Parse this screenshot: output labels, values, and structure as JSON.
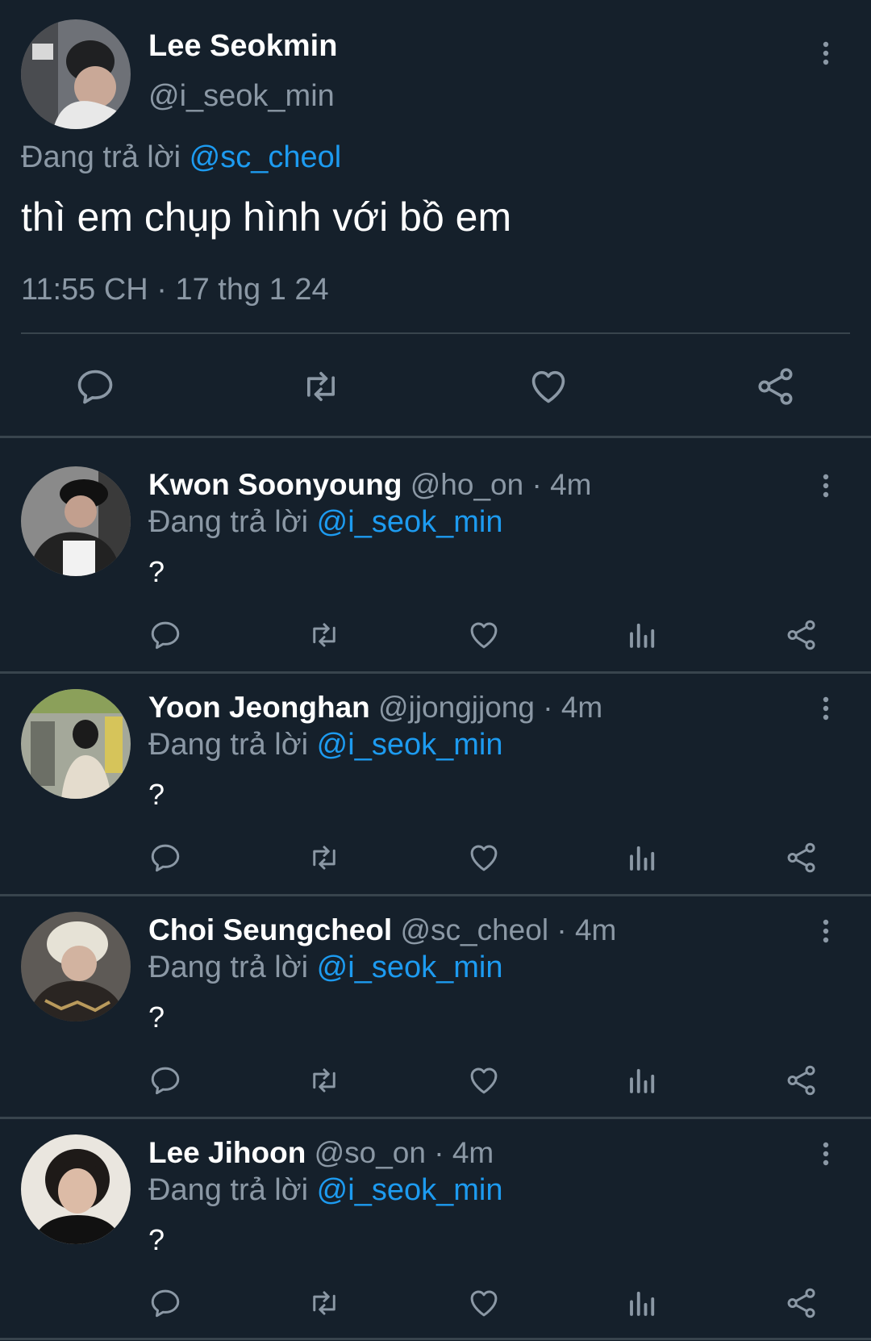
{
  "main_tweet": {
    "name": "Lee Seokmin",
    "handle": "@i_seok_min",
    "reply_prefix": "Đang trả lời",
    "reply_to": "@sc_cheol",
    "text": "thì em chụp hình với bồ em",
    "timestamp": "11:55 CH · 17 thg 1 24",
    "actions": [
      "reply-icon",
      "retweet-icon",
      "heart-icon",
      "share-icon"
    ]
  },
  "replies": [
    {
      "name": "Kwon Soonyoung",
      "handle": "@ho_on",
      "time": "4m",
      "reply_prefix": "Đang trả lời",
      "reply_to": "@i_seok_min",
      "text": "?"
    },
    {
      "name": "Yoon Jeonghan",
      "handle": "@jjongjjong",
      "time": "4m",
      "reply_prefix": "Đang trả lời",
      "reply_to": "@i_seok_min",
      "text": "?"
    },
    {
      "name": "Choi Seungcheol",
      "handle": "@sc_cheol",
      "time": "4m",
      "reply_prefix": "Đang trả lời",
      "reply_to": "@i_seok_min",
      "text": "?"
    },
    {
      "name": "Lee Jihoon",
      "handle": "@so_on",
      "time": "4m",
      "reply_prefix": "Đang trả lời",
      "reply_to": "@i_seok_min",
      "text": "?"
    }
  ],
  "reply_actions": [
    "reply-icon",
    "retweet-icon",
    "heart-icon",
    "analytics-icon",
    "share-icon"
  ],
  "colors": {
    "background": "#15202b",
    "text_primary": "#ffffff",
    "text_secondary": "#8b98a5",
    "accent": "#1d9bf0",
    "divider": "#38444d"
  },
  "separator": "·"
}
